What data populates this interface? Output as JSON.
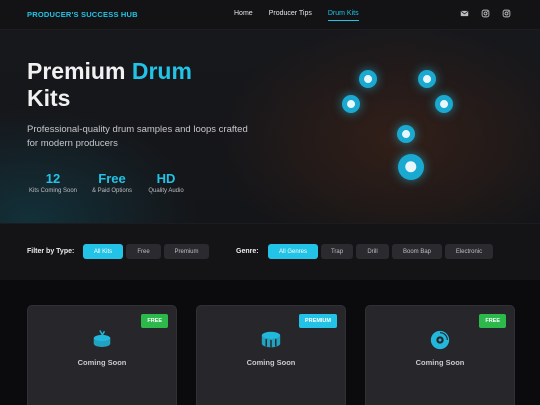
{
  "brand": "PRODUCER'S SUCCESS HUB",
  "nav": {
    "items": [
      {
        "label": "Home"
      },
      {
        "label": "Producer Tips"
      },
      {
        "label": "Drum Kits"
      }
    ],
    "active": "Drum Kits",
    "social_icons": [
      "email-icon",
      "instagram-icon",
      "instagram-icon"
    ]
  },
  "hero": {
    "title_part1": "Premium",
    "title_part2": "Drum",
    "title_part3": "Kits",
    "subtitle": "Professional-quality drum samples and loops crafted for modern producers",
    "stats": [
      {
        "number": "12",
        "label": "Kits Coming Soon"
      },
      {
        "number": "Free",
        "label": "& Paid Options"
      },
      {
        "number": "HD",
        "label": "Quality Audio"
      }
    ]
  },
  "filters": {
    "type_label": "Filter by Type:",
    "type_options": [
      "All Kits",
      "Free",
      "Premium"
    ],
    "type_selected": "All Kits",
    "genre_label": "Genre:",
    "genre_options": [
      "All Genres",
      "Trap",
      "Drill",
      "Boom Bap",
      "Electronic"
    ],
    "genre_selected": "All Genres"
  },
  "cards": [
    {
      "badge": "FREE",
      "badge_type": "free",
      "icon": "drum-icon",
      "status": "Coming Soon"
    },
    {
      "badge": "PREMIUM",
      "badge_type": "premium",
      "icon": "snare-drum-icon",
      "status": "Coming Soon"
    },
    {
      "badge": "FREE",
      "badge_type": "free",
      "icon": "record-disc-icon",
      "status": "Coming Soon"
    }
  ],
  "colors": {
    "accent": "#22c3e6",
    "free_badge": "#2db84c",
    "background": "#0e0e10"
  }
}
